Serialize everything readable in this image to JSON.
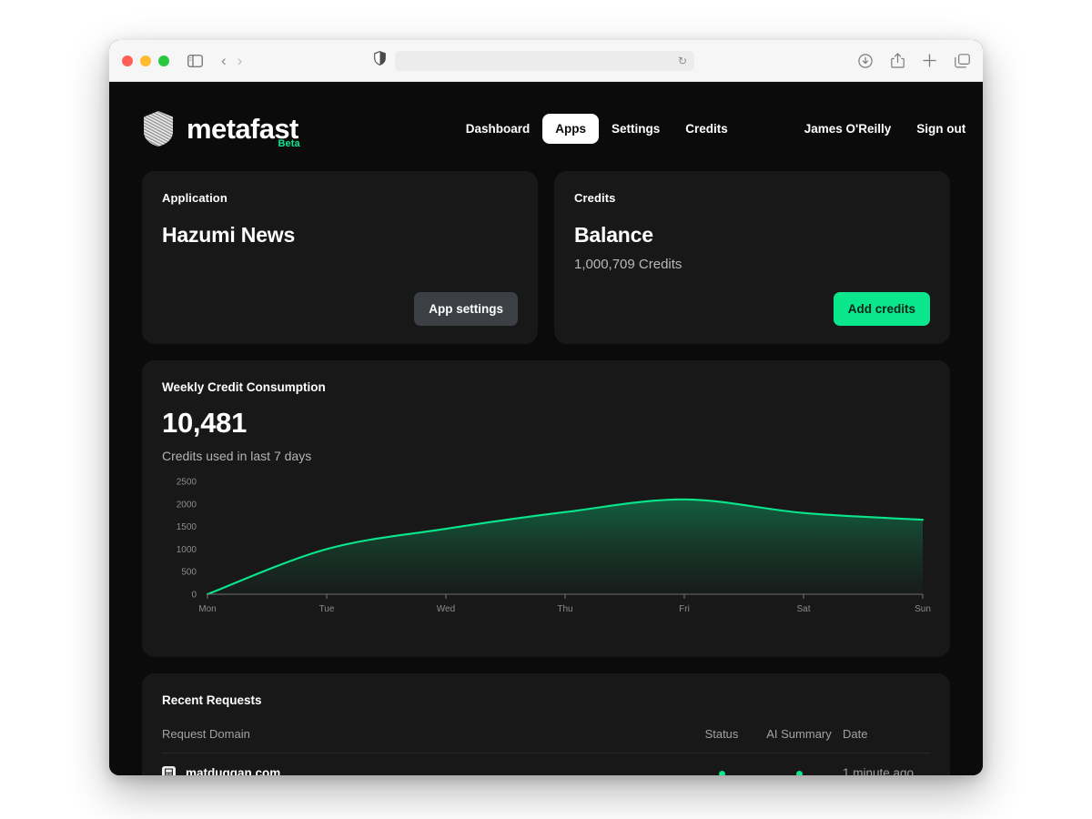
{
  "browser": {
    "address_value": "",
    "icons": {
      "sidebar": "sidebar-toggle-icon",
      "back": "back-arrow-icon",
      "forward": "forward-arrow-icon",
      "shield": "privacy-shield-icon",
      "reload": "reload-icon",
      "downloads": "downloads-icon",
      "share": "share-icon",
      "new_tab": "plus-icon",
      "tab_overview": "tab-overview-icon"
    }
  },
  "brand": {
    "name": "metafast",
    "badge": "Beta",
    "accent": "#0ae694"
  },
  "nav": {
    "items": [
      {
        "label": "Dashboard",
        "active": false
      },
      {
        "label": "Apps",
        "active": true
      },
      {
        "label": "Settings",
        "active": false
      },
      {
        "label": "Credits",
        "active": false
      }
    ],
    "user": "James O'Reilly",
    "sign_out": "Sign out"
  },
  "application_card": {
    "eyebrow": "Application",
    "title": "Hazumi News",
    "button": "App settings"
  },
  "credits_card": {
    "eyebrow": "Credits",
    "title": "Balance",
    "balance": "1,000,709 Credits",
    "button": "Add credits"
  },
  "consumption": {
    "title": "Weekly Credit Consumption",
    "total": "10,481",
    "caption": "Credits used in last 7 days"
  },
  "chart_data": {
    "type": "area",
    "title": "Weekly Credit Consumption",
    "xlabel": "",
    "ylabel": "",
    "categories": [
      "Mon",
      "Tue",
      "Wed",
      "Thu",
      "Fri",
      "Sat",
      "Sun"
    ],
    "values": [
      0,
      1000,
      1450,
      1820,
      2100,
      1800,
      1650
    ],
    "yticks": [
      0,
      500,
      1000,
      1500,
      2000,
      2500
    ],
    "ylim": [
      0,
      2500
    ],
    "grid": false,
    "legend": false,
    "line_color": "#0ae68c",
    "fill_gradient": [
      "rgba(10,230,140,0.35)",
      "rgba(10,230,140,0.02)"
    ],
    "curve": "smooth"
  },
  "requests": {
    "title": "Recent Requests",
    "columns": [
      "Request Domain",
      "Status",
      "AI Summary",
      "Date"
    ],
    "rows": [
      {
        "domain": "matduggan.com",
        "status": "ok",
        "ai_summary": "ok",
        "date": "1 minute ago"
      }
    ]
  }
}
